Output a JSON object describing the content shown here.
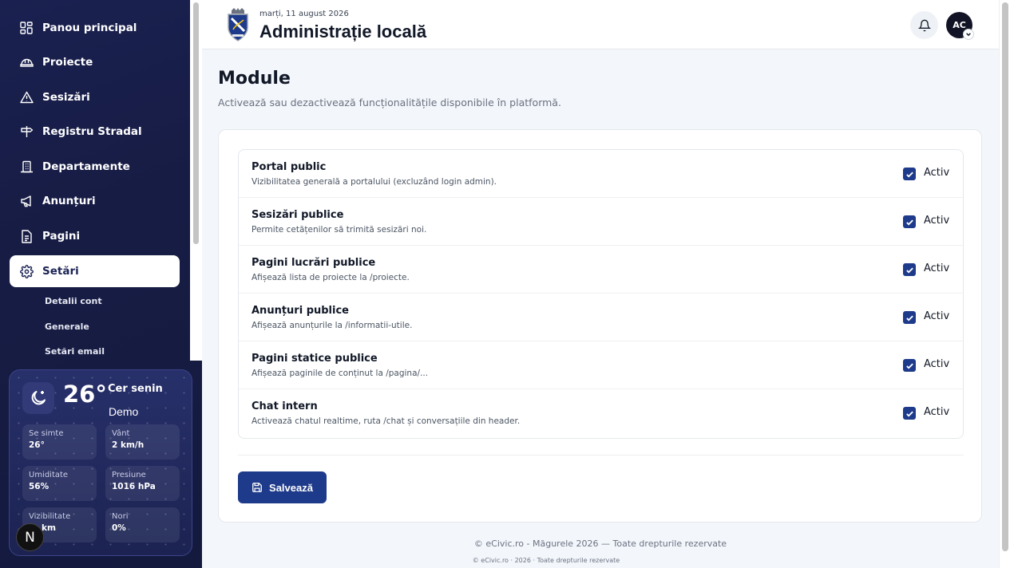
{
  "sidebar": {
    "items": [
      {
        "label": "Panou principal",
        "icon": "dashboard-icon"
      },
      {
        "label": "Proiecte",
        "icon": "helmet-icon"
      },
      {
        "label": "Sesizări",
        "icon": "warning-icon"
      },
      {
        "label": "Registru Stradal",
        "icon": "signpost-icon"
      },
      {
        "label": "Departamente",
        "icon": "building-icon"
      },
      {
        "label": "Anunțuri",
        "icon": "megaphone-icon"
      },
      {
        "label": "Pagini",
        "icon": "file-icon"
      },
      {
        "label": "Setări",
        "icon": "gear-icon",
        "active": true
      }
    ],
    "subitems": [
      "Detalii cont",
      "Generale",
      "Setări email"
    ]
  },
  "weather": {
    "temp": "26°",
    "condition": "Cer senin",
    "city": "Demo",
    "cells": [
      {
        "label": "Se simte",
        "value": "26°"
      },
      {
        "label": "Vânt",
        "value": "2 km/h"
      },
      {
        "label": "Umiditate",
        "value": "56%"
      },
      {
        "label": "Presiune",
        "value": "1016 hPa"
      },
      {
        "label": "Vizibilitate",
        "value": "km"
      },
      {
        "label": "Nori",
        "value": "0%"
      }
    ]
  },
  "badge": "N",
  "header": {
    "date": "marți, 11 august 2026",
    "title": "Administrație locală",
    "avatar_initials": "AC"
  },
  "page": {
    "title": "Module",
    "subtitle": "Activează sau dezactivează funcționalitățile disponibile în platformă."
  },
  "modules": [
    {
      "title": "Portal public",
      "desc": "Vizibilitatea generală a portalului (excluzând login admin).",
      "status": "Activ",
      "checked": true
    },
    {
      "title": "Sesizări publice",
      "desc": "Permite cetățenilor să trimită sesizări noi.",
      "status": "Activ",
      "checked": true
    },
    {
      "title": "Pagini lucrări publice",
      "desc": "Afișează lista de proiecte la /proiecte.",
      "status": "Activ",
      "checked": true
    },
    {
      "title": "Anunțuri publice",
      "desc": "Afișează anunțurile la /informatii-utile.",
      "status": "Activ",
      "checked": true
    },
    {
      "title": "Pagini statice publice",
      "desc": "Afișează paginile de conținut la /pagina/...",
      "status": "Activ",
      "checked": true
    },
    {
      "title": "Chat intern",
      "desc": "Activează chatul realtime, ruta /chat și conversațiile din header.",
      "status": "Activ",
      "checked": true
    }
  ],
  "save_label": "Salvează",
  "footer": {
    "line1": "© eCivic.ro - Măgurele 2026 — Toate drepturile rezervate",
    "line2": "© eCivic.ro · 2026 · Toate drepturile rezervate"
  },
  "colors": {
    "accent": "#1e3a8a",
    "sidebar": "#171c44"
  }
}
